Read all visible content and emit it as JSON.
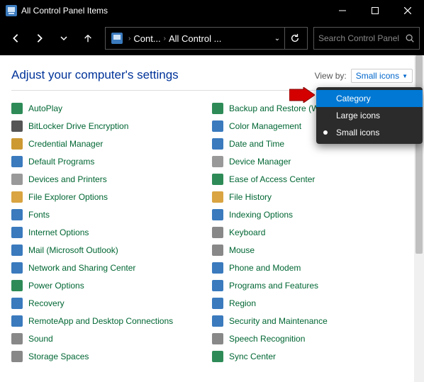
{
  "window": {
    "title": "All Control Panel Items"
  },
  "address": {
    "crumb1": "Cont...",
    "crumb2": "All Control ..."
  },
  "search": {
    "placeholder": "Search Control Panel"
  },
  "heading": "Adjust your computer's settings",
  "viewby": {
    "label": "View by:",
    "current": "Small icons"
  },
  "dropdown": {
    "items": [
      {
        "label": "Category",
        "highlighted": true,
        "selected": false
      },
      {
        "label": "Large icons",
        "highlighted": false,
        "selected": false
      },
      {
        "label": "Small icons",
        "highlighted": false,
        "selected": true
      }
    ]
  },
  "items_col1": [
    {
      "label": "AutoPlay",
      "icon": "#2e8b57"
    },
    {
      "label": "BitLocker Drive Encryption",
      "icon": "#555"
    },
    {
      "label": "Credential Manager",
      "icon": "#cc9933"
    },
    {
      "label": "Default Programs",
      "icon": "#3a7abd"
    },
    {
      "label": "Devices and Printers",
      "icon": "#999"
    },
    {
      "label": "File Explorer Options",
      "icon": "#d9a441"
    },
    {
      "label": "Fonts",
      "icon": "#3a7abd"
    },
    {
      "label": "Internet Options",
      "icon": "#3a7abd"
    },
    {
      "label": "Mail (Microsoft Outlook)",
      "icon": "#3a7abd"
    },
    {
      "label": "Network and Sharing Center",
      "icon": "#3a7abd"
    },
    {
      "label": "Power Options",
      "icon": "#2e8b57"
    },
    {
      "label": "Recovery",
      "icon": "#3a7abd"
    },
    {
      "label": "RemoteApp and Desktop Connections",
      "icon": "#3a7abd"
    },
    {
      "label": "Sound",
      "icon": "#888"
    },
    {
      "label": "Storage Spaces",
      "icon": "#888"
    }
  ],
  "items_col2": [
    {
      "label": "Backup and Restore (Windows",
      "icon": "#2e8b57"
    },
    {
      "label": "Color Management",
      "icon": "#3a7abd"
    },
    {
      "label": "Date and Time",
      "icon": "#3a7abd"
    },
    {
      "label": "Device Manager",
      "icon": "#999"
    },
    {
      "label": "Ease of Access Center",
      "icon": "#2e8b57"
    },
    {
      "label": "File History",
      "icon": "#d9a441"
    },
    {
      "label": "Indexing Options",
      "icon": "#3a7abd"
    },
    {
      "label": "Keyboard",
      "icon": "#888"
    },
    {
      "label": "Mouse",
      "icon": "#888"
    },
    {
      "label": "Phone and Modem",
      "icon": "#3a7abd"
    },
    {
      "label": "Programs and Features",
      "icon": "#3a7abd"
    },
    {
      "label": "Region",
      "icon": "#3a7abd"
    },
    {
      "label": "Security and Maintenance",
      "icon": "#3a7abd"
    },
    {
      "label": "Speech Recognition",
      "icon": "#888"
    },
    {
      "label": "Sync Center",
      "icon": "#2e8b57"
    }
  ]
}
